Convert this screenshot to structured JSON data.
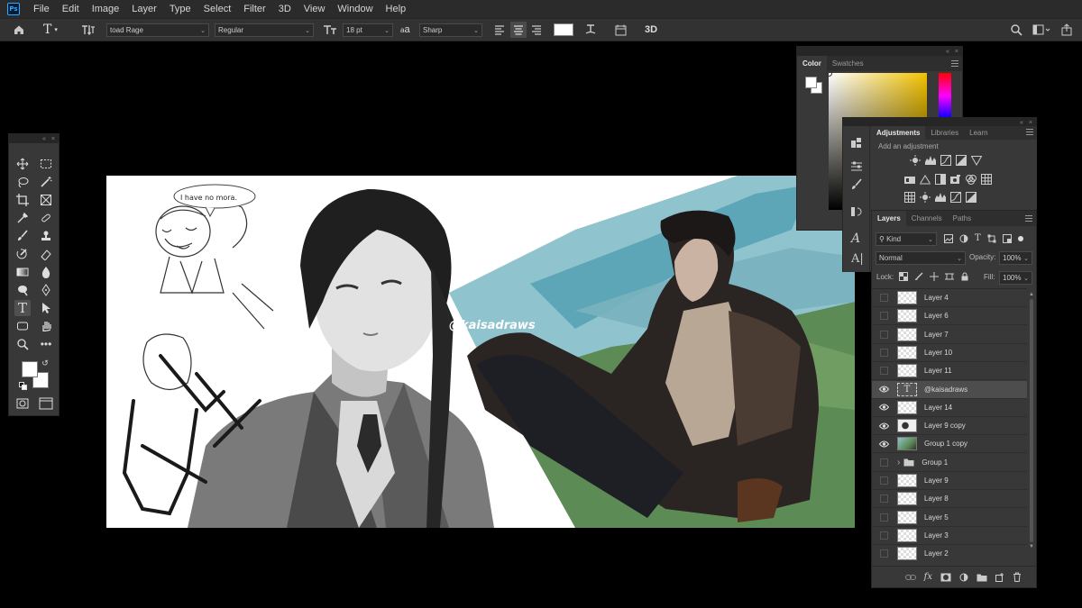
{
  "menu": {
    "logo": "Ps",
    "items": [
      "File",
      "Edit",
      "Image",
      "Layer",
      "Type",
      "Select",
      "Filter",
      "3D",
      "View",
      "Window",
      "Help"
    ]
  },
  "options": {
    "font_family": "toad Rage",
    "font_style": "Regular",
    "font_size": "18 pt",
    "aa_label": "a",
    "antialias": "Sharp",
    "three_d": "3D"
  },
  "color_panel": {
    "tabs": [
      "Color",
      "Swatches"
    ]
  },
  "adjustments_panel": {
    "tabs": [
      "Adjustments",
      "Libraries",
      "Learn"
    ],
    "hint": "Add an adjustment"
  },
  "layers_panel": {
    "tabs": [
      "Layers",
      "Channels",
      "Paths"
    ],
    "filter_kind": "Kind",
    "blend_mode": "Normal",
    "opacity_label": "Opacity:",
    "opacity": "100%",
    "lock_label": "Lock:",
    "fill_label": "Fill:",
    "fill": "100%",
    "layers": [
      {
        "name": "Layer 4",
        "visible": false,
        "type": "pixel"
      },
      {
        "name": "Layer 6",
        "visible": false,
        "type": "pixel"
      },
      {
        "name": "Layer 7",
        "visible": false,
        "type": "pixel"
      },
      {
        "name": "Layer 10",
        "visible": false,
        "type": "pixel"
      },
      {
        "name": "Layer 11",
        "visible": false,
        "type": "pixel"
      },
      {
        "name": "@kaisadraws",
        "visible": true,
        "type": "text",
        "selected": true
      },
      {
        "name": "Layer 14",
        "visible": true,
        "type": "pixel"
      },
      {
        "name": "Layer 9 copy",
        "visible": true,
        "type": "pixel"
      },
      {
        "name": "Group 1 copy",
        "visible": true,
        "type": "pixel"
      },
      {
        "name": "Group 1",
        "visible": false,
        "type": "group"
      },
      {
        "name": "Layer 9",
        "visible": false,
        "type": "pixel"
      },
      {
        "name": "Layer 8",
        "visible": false,
        "type": "pixel"
      },
      {
        "name": "Layer 5",
        "visible": false,
        "type": "pixel"
      },
      {
        "name": "Layer 3",
        "visible": false,
        "type": "pixel"
      },
      {
        "name": "Layer 2",
        "visible": false,
        "type": "pixel"
      }
    ],
    "type_glyph": "T"
  },
  "canvas": {
    "watermark": "@kaisadraws",
    "speech": "I have no mora."
  },
  "colors": {
    "app_bg": "#000000",
    "panel_bg": "#383838",
    "menubar_bg": "#2b2b2b",
    "sky_blue": "#8ec3cf",
    "grass_green": "#5f8a55"
  }
}
